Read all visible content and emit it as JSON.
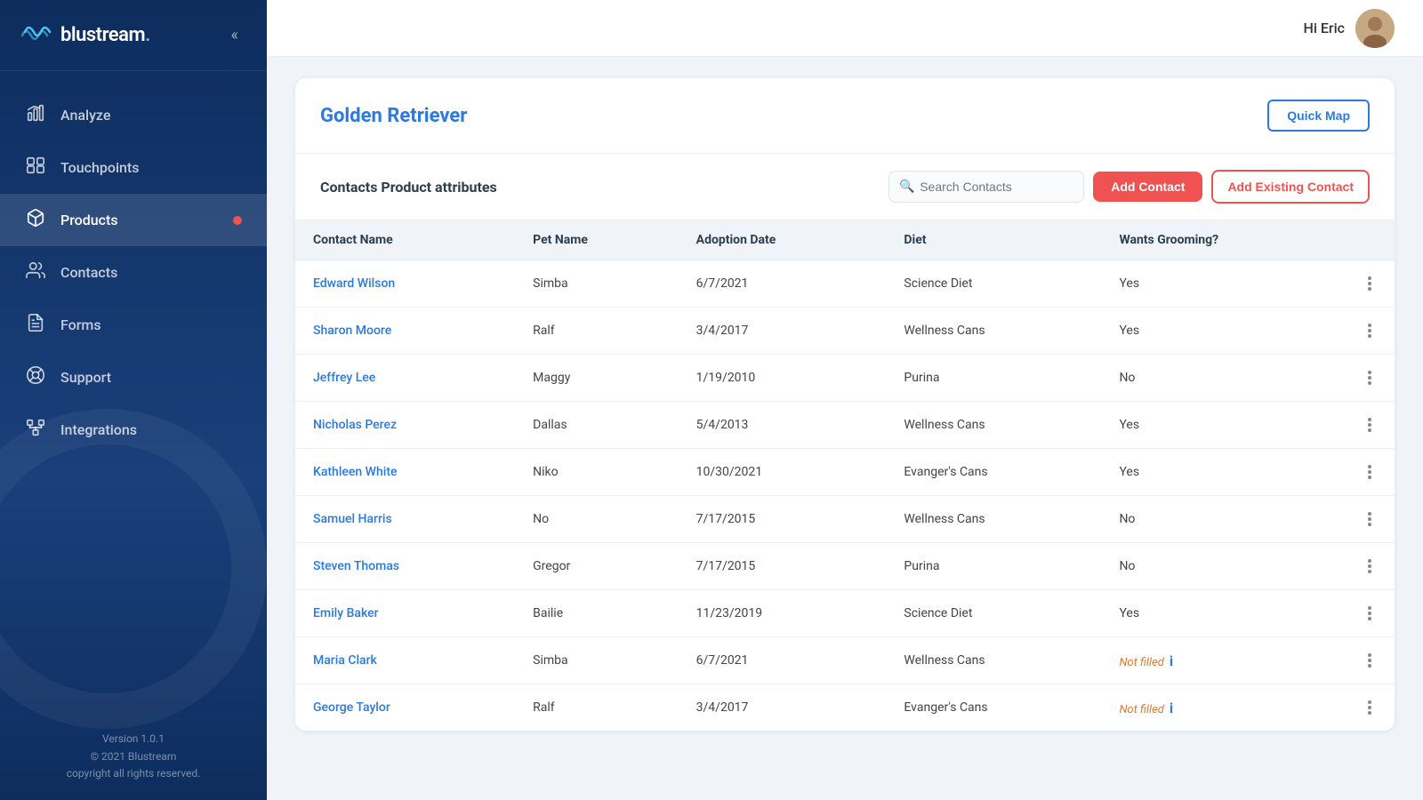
{
  "app": {
    "name": "blustream",
    "logo_symbol": "(((",
    "version": "Version 1.0.1",
    "copyright": "© 2021 Blustream",
    "copyright2": "copyright all rights reserved."
  },
  "header": {
    "greeting": "Hi Eric"
  },
  "sidebar": {
    "collapse_label": "«",
    "items": [
      {
        "id": "analyze",
        "label": "Analyze",
        "active": false,
        "badge": false
      },
      {
        "id": "touchpoints",
        "label": "Touchpoints",
        "active": false,
        "badge": false
      },
      {
        "id": "products",
        "label": "Products",
        "active": true,
        "badge": true
      },
      {
        "id": "contacts",
        "label": "Contacts",
        "active": false,
        "badge": false
      },
      {
        "id": "forms",
        "label": "Forms",
        "active": false,
        "badge": false
      },
      {
        "id": "support",
        "label": "Support",
        "active": false,
        "badge": false
      },
      {
        "id": "integrations",
        "label": "Integrations",
        "active": false,
        "badge": false
      }
    ]
  },
  "page": {
    "title": "Golden Retriever",
    "quick_map_label": "Quick Map",
    "section_title": "Contacts Product attributes",
    "search_placeholder": "Search Contacts",
    "add_contact_label": "Add Contact",
    "add_existing_label": "Add Existing Contact",
    "table": {
      "columns": [
        "Contact Name",
        "Pet Name",
        "Adoption Date",
        "Diet",
        "Wants Grooming?"
      ],
      "rows": [
        {
          "name": "Edward Wilson",
          "pet": "Simba",
          "date": "6/7/2021",
          "diet": "Science Diet",
          "grooming": "Yes",
          "not_filled": false
        },
        {
          "name": "Sharon Moore",
          "pet": "Ralf",
          "date": "3/4/2017",
          "diet": "Wellness Cans",
          "grooming": "Yes",
          "not_filled": false
        },
        {
          "name": "Jeffrey Lee",
          "pet": "Maggy",
          "date": "1/19/2010",
          "diet": "Purina",
          "grooming": "No",
          "not_filled": false
        },
        {
          "name": "Nicholas Perez",
          "pet": "Dallas",
          "date": "5/4/2013",
          "diet": "Wellness Cans",
          "grooming": "Yes",
          "not_filled": false
        },
        {
          "name": "Kathleen White",
          "pet": "Niko",
          "date": "10/30/2021",
          "diet": "Evanger's Cans",
          "grooming": "Yes",
          "not_filled": false
        },
        {
          "name": "Samuel Harris",
          "pet": "No",
          "date": "7/17/2015",
          "diet": "Wellness Cans",
          "grooming": "No",
          "not_filled": false
        },
        {
          "name": "Steven Thomas",
          "pet": "Gregor",
          "date": "7/17/2015",
          "diet": "Purina",
          "grooming": "No",
          "not_filled": false
        },
        {
          "name": "Emily Baker",
          "pet": "Bailie",
          "date": "11/23/2019",
          "diet": "Science Diet",
          "grooming": "Yes",
          "not_filled": false
        },
        {
          "name": "Maria Clark",
          "pet": "Simba",
          "date": "6/7/2021",
          "diet": "Wellness Cans",
          "grooming": "Not filled",
          "not_filled": true
        },
        {
          "name": "George Taylor",
          "pet": "Ralf",
          "date": "3/4/2017",
          "diet": "Evanger's Cans",
          "grooming": "Not filled",
          "not_filled": true
        }
      ]
    }
  },
  "colors": {
    "accent": "#2a7ae2",
    "sidebar_bg": "#0d2d5e",
    "danger": "#f05252",
    "not_filled": "#e07a2f"
  }
}
